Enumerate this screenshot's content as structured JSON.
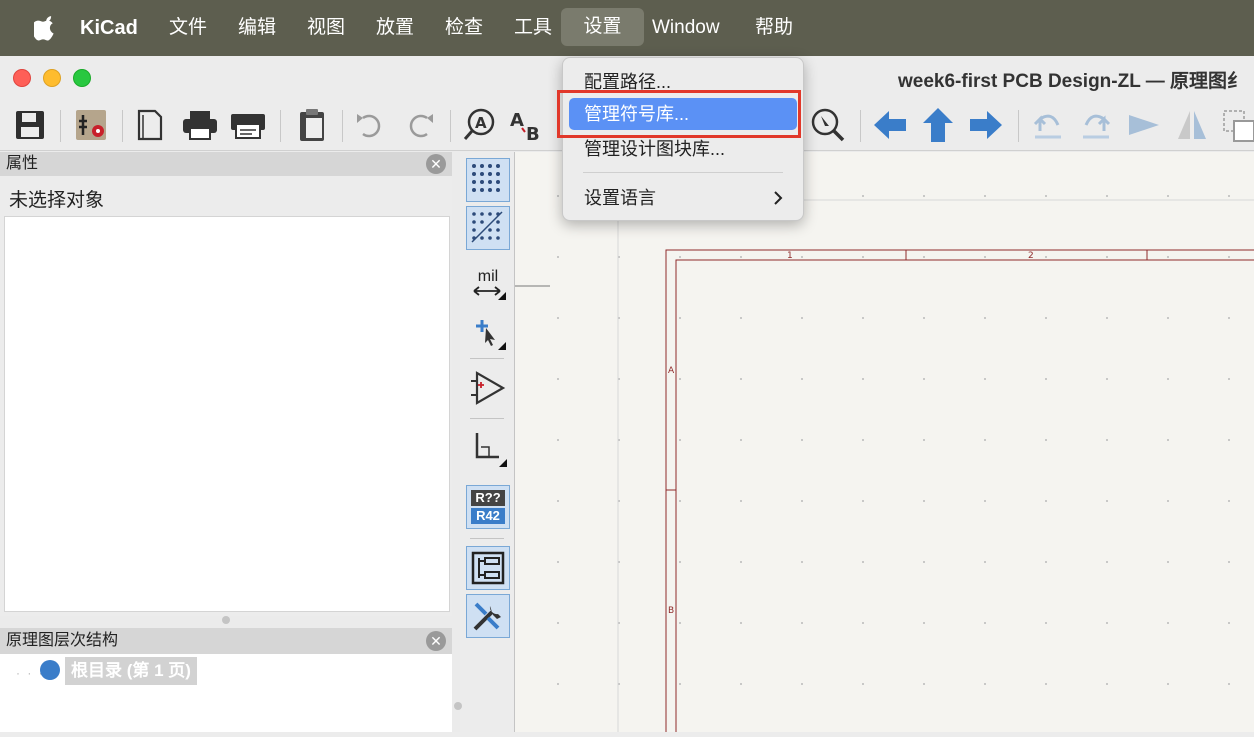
{
  "menubar": {
    "apple_icon": "apple-icon",
    "app_name": "KiCad",
    "items": [
      "文件",
      "编辑",
      "视图",
      "放置",
      "检查",
      "工具",
      "设置",
      "Window",
      "帮助"
    ],
    "active_item": "设置"
  },
  "window": {
    "title": "week6-first PCB Design-ZL — 原理图纟",
    "traffic_colors": [
      "#fe5f57",
      "#febc2e",
      "#28c840"
    ]
  },
  "settings_menu": {
    "items": [
      {
        "label": "配置路径..."
      },
      {
        "label": "管理符号库..."
      },
      {
        "label": "管理设计图块库..."
      },
      {
        "label": "设置语言",
        "submenu_icon": "chevron-right-icon"
      }
    ],
    "selected": "管理符号库..."
  },
  "properties_panel": {
    "title": "属性",
    "empty_text": "未选择对象",
    "close_icon": "close-icon"
  },
  "hierarchy_panel": {
    "title": "原理图层次结构",
    "root_label": "根目录 (第 1 页)",
    "close_icon": "close-icon"
  },
  "left_toolbar": {
    "units_label": "mil",
    "annotate_top": "R??",
    "annotate_bottom": "R42"
  },
  "sheet": {
    "col_labels": [
      "1",
      "2"
    ],
    "row_labels": [
      "A",
      "B"
    ],
    "border_color": "#8f2a2a"
  },
  "colors": {
    "accent_blue": "#3a7dc9",
    "highlight_red": "#e1382a",
    "menu_selection": "#5b91f5"
  }
}
